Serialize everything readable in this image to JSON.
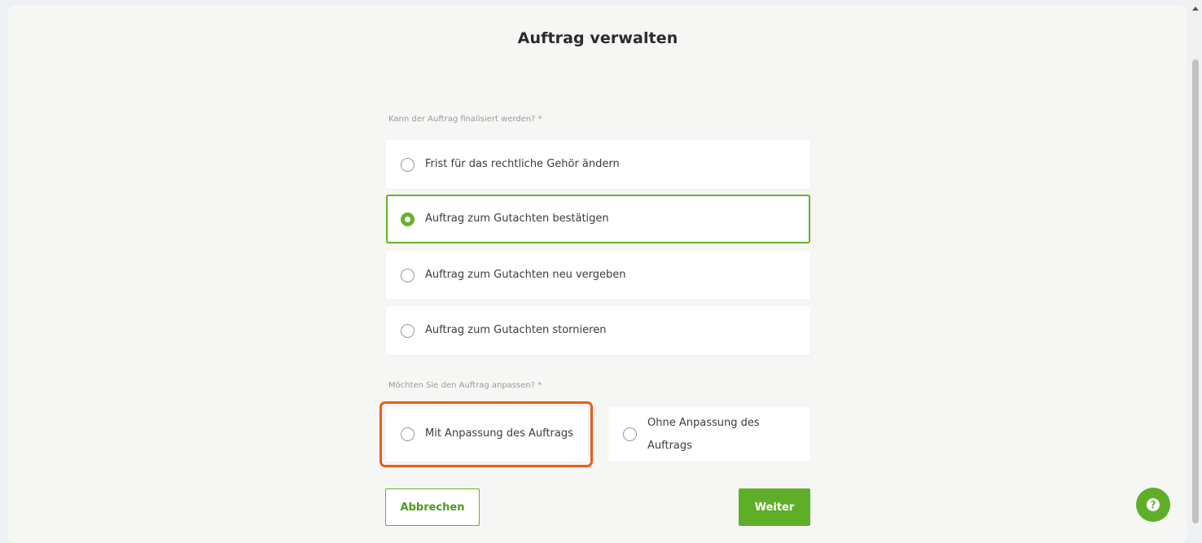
{
  "dialog": {
    "title": "Auftrag verwalten"
  },
  "question1": {
    "label": "Kann der Auftrag finalisiert werden? *",
    "options": [
      {
        "label": "Frist für das rechtliche Gehör ändern",
        "selected": false
      },
      {
        "label": "Auftrag zum Gutachten bestätigen",
        "selected": true
      },
      {
        "label": "Auftrag zum Gutachten neu vergeben",
        "selected": false
      },
      {
        "label": "Auftrag zum Gutachten stornieren",
        "selected": false
      }
    ]
  },
  "question2": {
    "label": "Möchten Sie den Auftrag anpassen? *",
    "options": [
      {
        "label": "Mit Anpassung des Auftrags",
        "selected": false
      },
      {
        "label": "Ohne Anpassung des Auftrags",
        "selected": false
      }
    ]
  },
  "buttons": {
    "cancel": "Abbrechen",
    "next": "Weiter",
    "help": "?"
  },
  "colors": {
    "accent": "#5fae28",
    "highlight": "#f05a1a"
  }
}
